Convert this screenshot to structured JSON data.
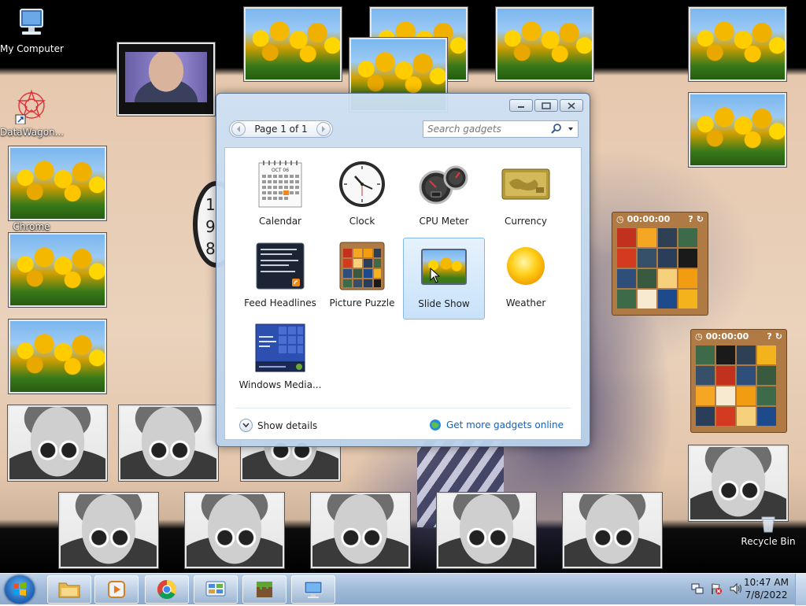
{
  "desktop": {
    "icons": {
      "my_computer": "My Computer",
      "datawagon": "DataWagon...",
      "chrome": "Chrome",
      "recycle_bin": "Recycle Bin"
    },
    "puzzle_timers": [
      "00:00:00",
      "00:00:00"
    ]
  },
  "gadget_window": {
    "page_label": "Page 1 of 1",
    "search_placeholder": "Search gadgets",
    "gadgets": [
      {
        "label": "Calendar",
        "icon": "calendar-icon"
      },
      {
        "label": "Clock",
        "icon": "clock-icon"
      },
      {
        "label": "CPU Meter",
        "icon": "cpu-meter-icon"
      },
      {
        "label": "Currency",
        "icon": "currency-icon"
      },
      {
        "label": "Feed Headlines",
        "icon": "feed-headlines-icon"
      },
      {
        "label": "Picture Puzzle",
        "icon": "picture-puzzle-icon"
      },
      {
        "label": "Slide Show",
        "icon": "slide-show-icon",
        "selected": true
      },
      {
        "label": "Weather",
        "icon": "weather-icon"
      },
      {
        "label": "Windows Media...",
        "icon": "windows-media-icon"
      }
    ],
    "calendar_month": "OCT 06",
    "show_details": "Show details",
    "get_more": "Get more gadgets online"
  },
  "taskbar": {
    "time": "10:47 AM",
    "date": "7/8/2022"
  },
  "colors": {
    "accent": "#0c64c0",
    "selection": "#c8e2fa",
    "taskbar": "#9fb9d7"
  }
}
